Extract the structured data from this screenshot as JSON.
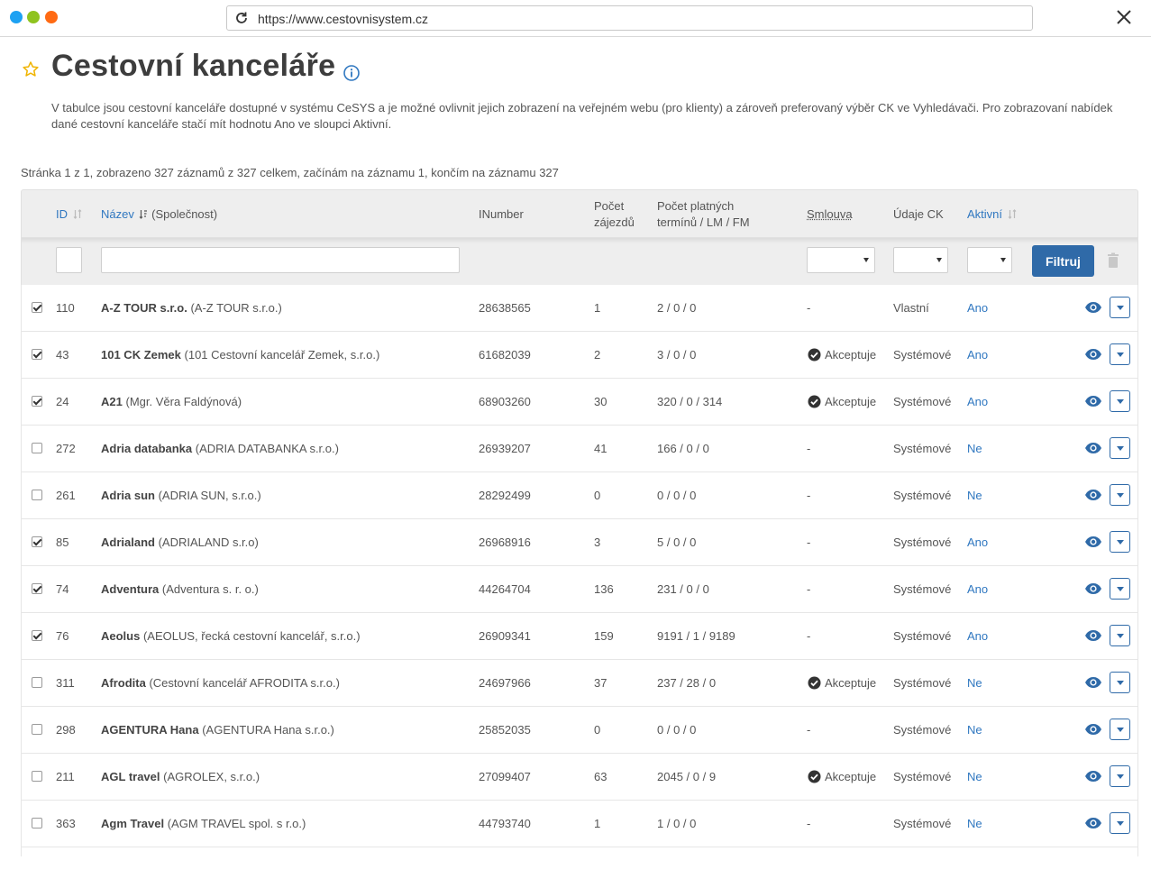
{
  "browser": {
    "url": "https://www.cestovnisystem.cz",
    "dots": [
      "#1da1f2",
      "#8fc31f",
      "#ff6a13"
    ]
  },
  "page": {
    "title": "Cestovní kanceláře",
    "description": "V tabulce jsou cestovní kanceláře dostupné v systému CeSYS a je možné ovlivnit jejich zobrazení na veřejném webu (pro klienty) a zároveň preferovaný výběr CK ve Vyhledávači. Pro zobrazovaní nabídek dané cestovní kanceláře stačí mít hodnotu Ano ve sloupci Aktivní.",
    "page_info": "Stránka 1 z 1, zobrazeno 327 záznamů z 327 celkem, začínám na záznamu 1, končím na záznamu 327"
  },
  "table": {
    "headers": {
      "id": "ID",
      "name_link": "Název",
      "name_rest": "(Společnost)",
      "inumber": "INumber",
      "trips_1": "Počet",
      "trips_2": "zájezdů",
      "terms_1": "Počet platných",
      "terms_2": "termínů / LM / FM",
      "contract": "Smlouva",
      "data": "Údaje CK",
      "active": "Aktivní"
    },
    "filter_button": "Filtruj",
    "rows": [
      {
        "checked": true,
        "id": "110",
        "name": "A-Z TOUR s.r.o.",
        "company": "(A-Z TOUR s.r.o.)",
        "inumber": "28638565",
        "trips": "1",
        "terms": "2 / 0 / 0",
        "contract": "-",
        "data": "Vlastní",
        "active": "Ano"
      },
      {
        "checked": true,
        "id": "43",
        "name": "101 CK Zemek",
        "company": "(101 Cestovní kancelář Zemek, s.r.o.)",
        "inumber": "61682039",
        "trips": "2",
        "terms": "3 / 0 / 0",
        "contract": "Akceptuje",
        "data": "Systémové",
        "active": "Ano"
      },
      {
        "checked": true,
        "id": "24",
        "name": "A21",
        "company": "(Mgr. Věra Faldýnová)",
        "inumber": "68903260",
        "trips": "30",
        "terms": "320 / 0 / 314",
        "contract": "Akceptuje",
        "data": "Systémové",
        "active": "Ano"
      },
      {
        "checked": false,
        "id": "272",
        "name": "Adria databanka",
        "company": "(ADRIA DATABANKA s.r.o.)",
        "inumber": "26939207",
        "trips": "41",
        "terms": "166 / 0 / 0",
        "contract": "-",
        "data": "Systémové",
        "active": "Ne"
      },
      {
        "checked": false,
        "id": "261",
        "name": "Adria sun",
        "company": "(ADRIA SUN, s.r.o.)",
        "inumber": "28292499",
        "trips": "0",
        "terms": "0 / 0 / 0",
        "contract": "-",
        "data": "Systémové",
        "active": "Ne"
      },
      {
        "checked": true,
        "id": "85",
        "name": "Adrialand",
        "company": "(ADRIALAND s.r.o)",
        "inumber": "26968916",
        "trips": "3",
        "terms": "5 / 0 / 0",
        "contract": "-",
        "data": "Systémové",
        "active": "Ano"
      },
      {
        "checked": true,
        "id": "74",
        "name": "Adventura",
        "company": "(Adventura s. r. o.)",
        "inumber": "44264704",
        "trips": "136",
        "terms": "231 / 0 / 0",
        "contract": "-",
        "data": "Systémové",
        "active": "Ano"
      },
      {
        "checked": true,
        "id": "76",
        "name": "Aeolus",
        "company": "(AEOLUS, řecká cestovní kancelář, s.r.o.)",
        "inumber": "26909341",
        "trips": "159",
        "terms": "9191 / 1 / 9189",
        "contract": "-",
        "data": "Systémové",
        "active": "Ano"
      },
      {
        "checked": false,
        "id": "311",
        "name": "Afrodita",
        "company": "(Cestovní kancelář AFRODITA s.r.o.)",
        "inumber": "24697966",
        "trips": "37",
        "terms": "237 / 28 / 0",
        "contract": "Akceptuje",
        "data": "Systémové",
        "active": "Ne"
      },
      {
        "checked": false,
        "id": "298",
        "name": "AGENTURA Hana",
        "company": "(AGENTURA Hana s.r.o.)",
        "inumber": "25852035",
        "trips": "0",
        "terms": "0 / 0 / 0",
        "contract": "-",
        "data": "Systémové",
        "active": "Ne"
      },
      {
        "checked": false,
        "id": "211",
        "name": "AGL travel",
        "company": "(AGROLEX, s.r.o.)",
        "inumber": "27099407",
        "trips": "63",
        "terms": "2045 / 0 / 9",
        "contract": "Akceptuje",
        "data": "Systémové",
        "active": "Ne"
      },
      {
        "checked": false,
        "id": "363",
        "name": "Agm Travel",
        "company": "(AGM TRAVEL spol. s r.o.)",
        "inumber": "44793740",
        "trips": "1",
        "terms": "1 / 0 / 0",
        "contract": "-",
        "data": "Systémové",
        "active": "Ne"
      }
    ]
  },
  "icons": {
    "reload": "reload-icon",
    "close": "close-icon",
    "favorite": "star-icon",
    "info": "info-icon",
    "sort": "sort-icon",
    "trash": "trash-icon",
    "view": "eye-icon",
    "accept": "check-circle-icon",
    "dropdown": "chevron-down-icon"
  },
  "colors": {
    "accent": "#2f77c0",
    "button": "#2f6aa8",
    "star": "#f0b400"
  }
}
